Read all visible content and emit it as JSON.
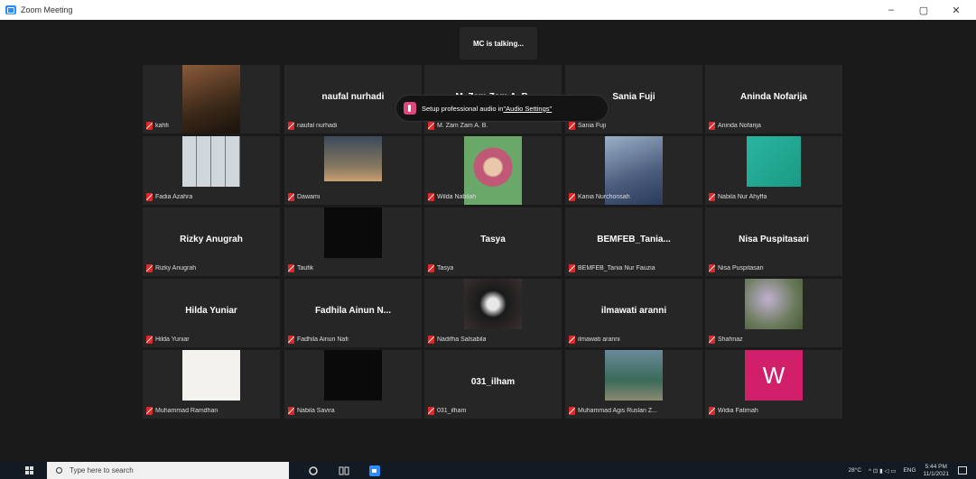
{
  "window": {
    "title": "Zoom Meeting",
    "controls": [
      "–",
      "▢",
      "✕"
    ]
  },
  "meeting": {
    "talking_indicator": "MC is talking...",
    "toast": {
      "text": "Setup professional audio in ",
      "link": "\"Audio Settings\""
    },
    "tiles": [
      {
        "center": "",
        "label": "kahfi",
        "video": "person-dark"
      },
      {
        "center": "naufal nurhadi",
        "label": "naufal nurhadi",
        "video": ""
      },
      {
        "center": "M. Zam Zam A. B.",
        "label": "M. Zam Zam A. B.",
        "video": ""
      },
      {
        "center": "Sania Fuji",
        "label": "Sania Fuji",
        "video": ""
      },
      {
        "center": "Aninda Nofarija",
        "label": "Aninda Nofarija",
        "video": ""
      },
      {
        "center": "",
        "label": "Fadia Azahra",
        "video": "grid-photos"
      },
      {
        "center": "",
        "label": "Dawami",
        "video": "room"
      },
      {
        "center": "",
        "label": "Wilda Nabilah",
        "video": "hijab-girl"
      },
      {
        "center": "",
        "label": "Kania Nurchonsah",
        "video": "hijab-blue"
      },
      {
        "center": "",
        "label": "Nabila Nur Ahyffa",
        "video": "teal"
      },
      {
        "center": "Rizky Anugrah",
        "label": "Rizky Anugrah",
        "video": ""
      },
      {
        "center": "",
        "label": "Taufik",
        "video": "black"
      },
      {
        "center": "Tasya",
        "label": "Tasya",
        "video": ""
      },
      {
        "center": "BEMFEB_Tania...",
        "label": "BEMFEB_Tania Nur Fauzia",
        "video": ""
      },
      {
        "center": "Nisa Puspitasari",
        "label": "Nisa Puspitasari",
        "video": ""
      },
      {
        "center": "Hilda Yuniar",
        "label": "Hilda Yuniar",
        "video": ""
      },
      {
        "center": "Fadhila Ainun N...",
        "label": "Fadhila Ainun Nafi",
        "video": ""
      },
      {
        "center": "",
        "label": "Nadifha Salsabila",
        "video": "masked"
      },
      {
        "center": "ilmawati aranni",
        "label": "ilmawati aranni",
        "video": ""
      },
      {
        "center": "",
        "label": "Shahnaz",
        "video": "flowers"
      },
      {
        "center": "",
        "label": "Muhammad Ramdhan",
        "video": "white"
      },
      {
        "center": "",
        "label": "Nabila Savira",
        "video": "black"
      },
      {
        "center": "031_ilham",
        "label": "031_ilham",
        "video": ""
      },
      {
        "center": "",
        "label": "Muhammad Agis Ruslan Z...",
        "video": "room-green"
      },
      {
        "center": "",
        "label": "Widia Fatimah",
        "video": "avatar-w",
        "avatar_letter": "W"
      }
    ]
  },
  "taskbar": {
    "search_placeholder": "Type here to search",
    "weather": "28°C",
    "lang": "ENG",
    "time": "5:44 PM",
    "date": "11/1/2021"
  },
  "colors": {
    "accent": "#2d8cff",
    "muted_mic": "#e02828",
    "avatar_w": "#d21f6a"
  }
}
